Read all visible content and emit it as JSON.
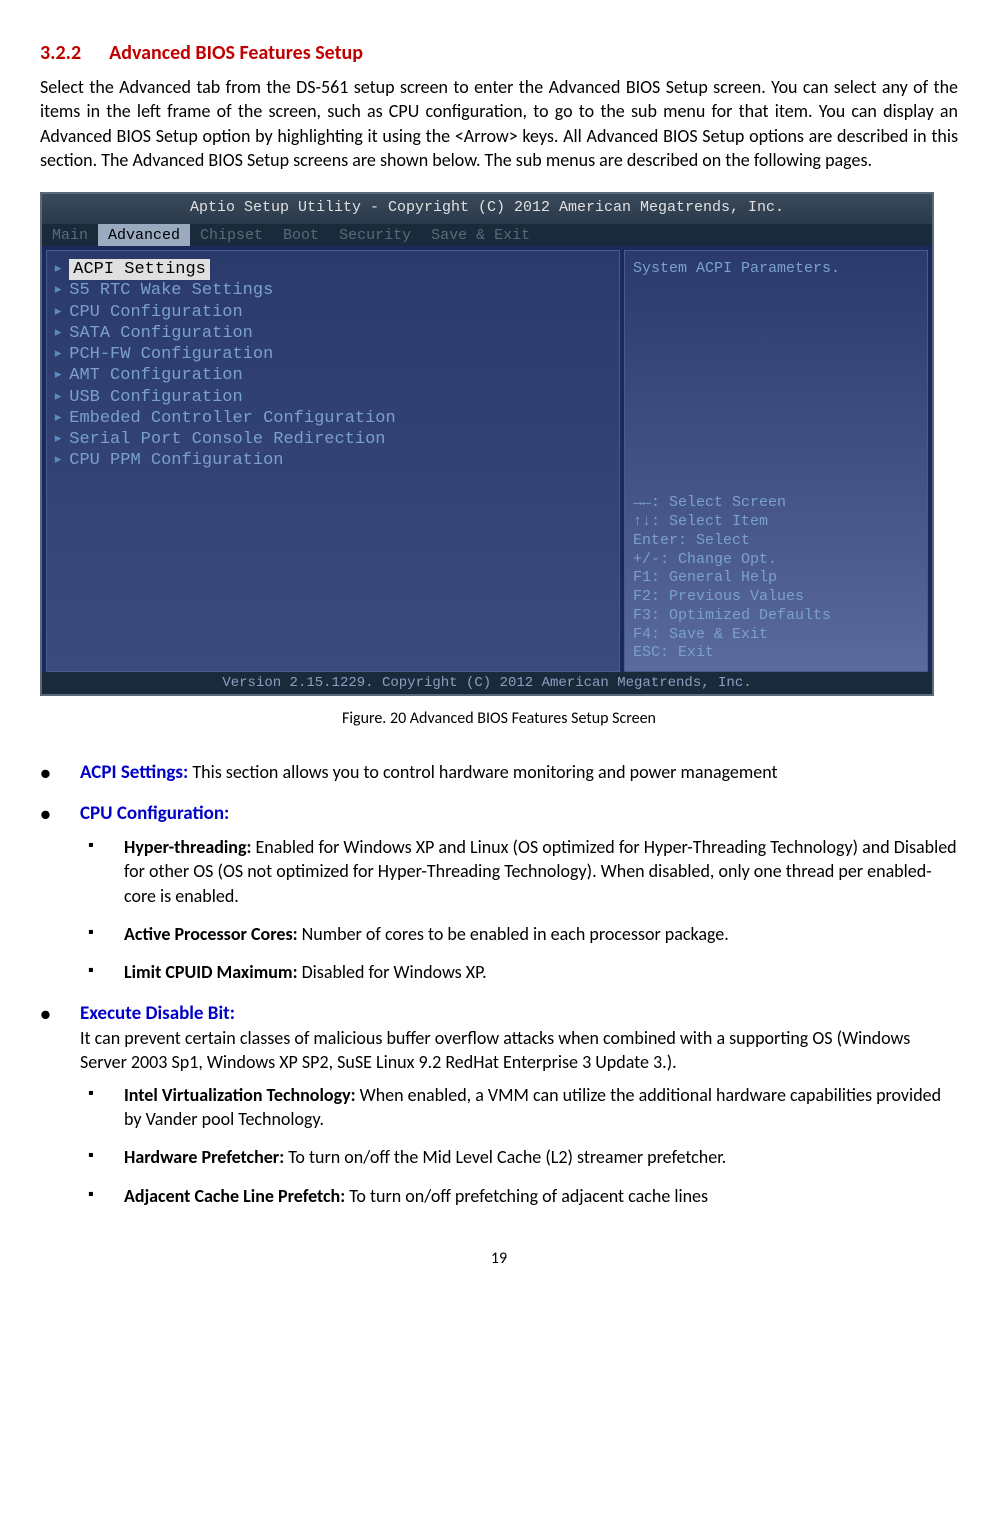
{
  "heading": {
    "num": "3.2.2",
    "title": "Advanced BIOS Features Setup"
  },
  "intro": "Select the Advanced tab from the DS-561 setup screen to enter the Advanced BIOS Setup screen. You can select any of the items in the left frame of the screen, such as CPU configuration, to go to the sub menu for that item. You can display an Advanced BIOS Setup option by highlighting it using the <Arrow> keys. All Advanced BIOS Setup options are described in this section. The Advanced BIOS Setup screens are shown below. The sub menus are described on the following pages.",
  "bios": {
    "topbar": "Aptio Setup Utility - Copyright (C) 2012 American Megatrends, Inc.",
    "tabs": [
      "Main",
      "Advanced",
      "Chipset",
      "Boot",
      "Security",
      "Save & Exit"
    ],
    "active_tab": "Advanced",
    "menu": [
      "ACPI Settings",
      "S5 RTC Wake Settings",
      "CPU Configuration",
      "SATA Configuration",
      "PCH-FW Configuration",
      "AMT Configuration",
      "USB Configuration",
      "Embeded Controller Configuration",
      "Serial Port Console Redirection",
      "CPU PPM Configuration"
    ],
    "right_top": "System ACPI Parameters.",
    "help": [
      "→←: Select Screen",
      "↑↓: Select Item",
      "Enter: Select",
      "+/-: Change Opt.",
      "F1: General Help",
      "F2: Previous Values",
      "F3: Optimized Defaults",
      "F4: Save & Exit",
      "ESC: Exit"
    ],
    "bottombar": "Version 2.15.1229. Copyright (C) 2012 American Megatrends, Inc."
  },
  "caption": "Figure. 20 Advanced BIOS Features Setup Screen",
  "items": {
    "acpi": {
      "title": "ACPI Settings:",
      "text": " This section allows you to control hardware monitoring and power management"
    },
    "cpu": {
      "title": "CPU Configuration:",
      "subs": [
        {
          "b": "Hyper-threading:",
          "t": " Enabled for Windows XP and Linux (OS optimized for Hyper-Threading Technology) and Disabled for other OS (OS not optimized for Hyper-Threading Technology). When disabled, only one thread per enabled-core is enabled."
        },
        {
          "b": "Active Processor Cores:",
          "t": " Number of cores to be enabled in each processor package."
        },
        {
          "b": "Limit CPUID Maximum:",
          "t": " Disabled for Windows XP."
        }
      ]
    },
    "exec": {
      "title": "Execute Disable Bit:",
      "text": "It can prevent certain classes of malicious buffer overflow attacks when combined with a supporting OS (Windows Server 2003 Sp1, Windows XP SP2, SuSE Linux 9.2 RedHat Enterprise 3 Update 3.).",
      "subs": [
        {
          "b": "Intel Virtualization Technology:",
          "t": " When enabled, a VMM can utilize the additional hardware capabilities provided by Vander pool Technology."
        },
        {
          "b": "Hardware Prefetcher:",
          "t": " To turn on/off the Mid Level Cache (L2) streamer prefetcher."
        },
        {
          "b": "Adjacent Cache Line Prefetch:",
          "t": " To turn on/off prefetching of adjacent cache lines"
        }
      ]
    }
  },
  "pagenum": "19"
}
